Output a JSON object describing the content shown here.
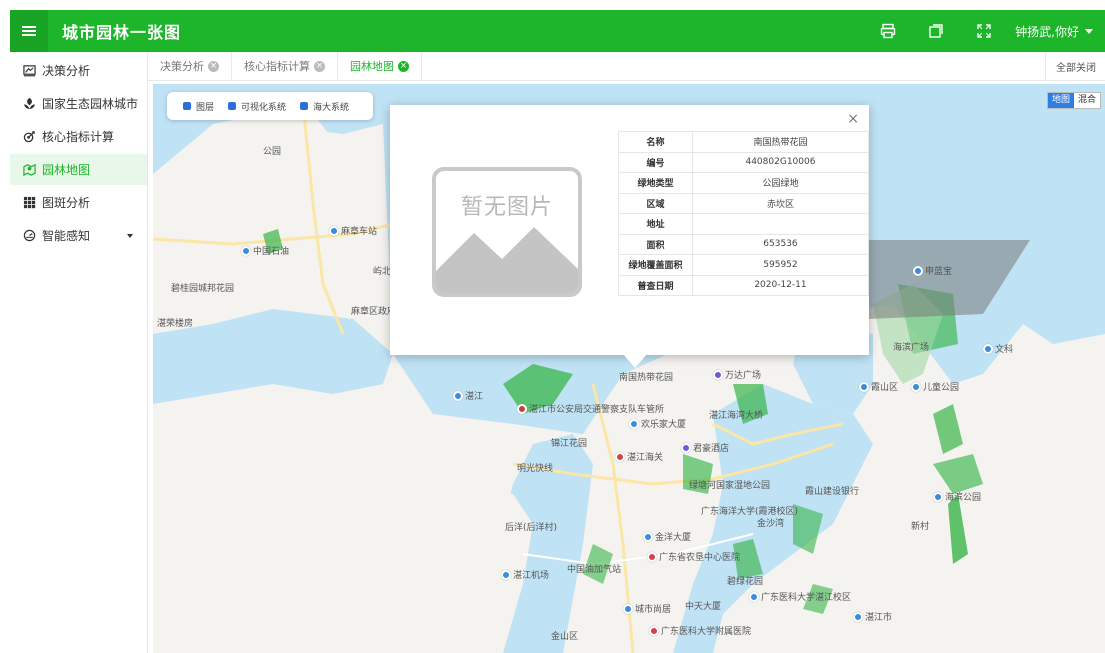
{
  "header": {
    "title": "城市园林一张图",
    "user": "钟扬武,你好",
    "icons": [
      "print-icon",
      "copy-window-icon",
      "fullscreen-icon"
    ]
  },
  "sidebar": {
    "items": [
      {
        "label": "决策分析",
        "icon": "chart-icon"
      },
      {
        "label": "国家生态园林城市",
        "icon": "leaf-icon"
      },
      {
        "label": "核心指标计算",
        "icon": "target-icon"
      },
      {
        "label": "园林地图",
        "icon": "map-icon",
        "active": true
      },
      {
        "label": "图斑分析",
        "icon": "grid-icon"
      },
      {
        "label": "智能感知",
        "icon": "gauge-icon",
        "has_children": true
      }
    ]
  },
  "tabs": {
    "items": [
      {
        "label": "决策分析"
      },
      {
        "label": "核心指标计算"
      },
      {
        "label": "园林地图",
        "active": true
      }
    ],
    "close_all": "全部关闭"
  },
  "map": {
    "layers": [
      "图层",
      "可视化系统",
      "海大系统"
    ],
    "map_type": {
      "options": [
        "地图",
        "混合"
      ],
      "selected": "地图"
    },
    "labels": [
      "中国石油",
      "麻章车站",
      "碧桂园城邦花园",
      "湛荣楼房",
      "麻章区政府",
      "公园",
      "屿北",
      "万达广场",
      "湛江市公安局交通警察支队车管所",
      "欢乐家大厦",
      "湛江海湾大桥",
      "锦江花园",
      "湛江海关",
      "君豪酒店",
      "南国热带花园",
      "明光快线",
      "绿塘河国家湿地公园",
      "广东海洋大学(霞港校区)",
      "金洋大厦",
      "广东省农垦中心医院",
      "中国油加气站",
      "城市尚居",
      "中天大厦",
      "广东医科大学附属医院",
      "碧绿花园",
      "广东医科大学湛江校区",
      "霞山建设银行",
      "湛江机场",
      "后洋(后洋村)",
      "金山区",
      "海滨广场",
      "海滨公园",
      "金沙湾",
      "霞山区",
      "湛江市",
      "湛江",
      "儿童公园",
      "申蓝宝",
      "新村",
      "文科"
    ]
  },
  "popup": {
    "no_image_text": "暂无图片",
    "fields": [
      {
        "key": "名称",
        "value": "南国热带花园"
      },
      {
        "key": "编号",
        "value": "440802G10006"
      },
      {
        "key": "绿地类型",
        "value": "公园绿地"
      },
      {
        "key": "区域",
        "value": "赤坎区"
      },
      {
        "key": "地址",
        "value": ""
      },
      {
        "key": "面积",
        "value": "653536"
      },
      {
        "key": "绿地覆盖面积",
        "value": "595952"
      },
      {
        "key": "普查日期",
        "value": "2020-12-11"
      }
    ]
  },
  "colors": {
    "brand": "#1db52a",
    "water": "#bfe2f5",
    "land": "#f4f3ef",
    "green_space": "#39b54a"
  }
}
